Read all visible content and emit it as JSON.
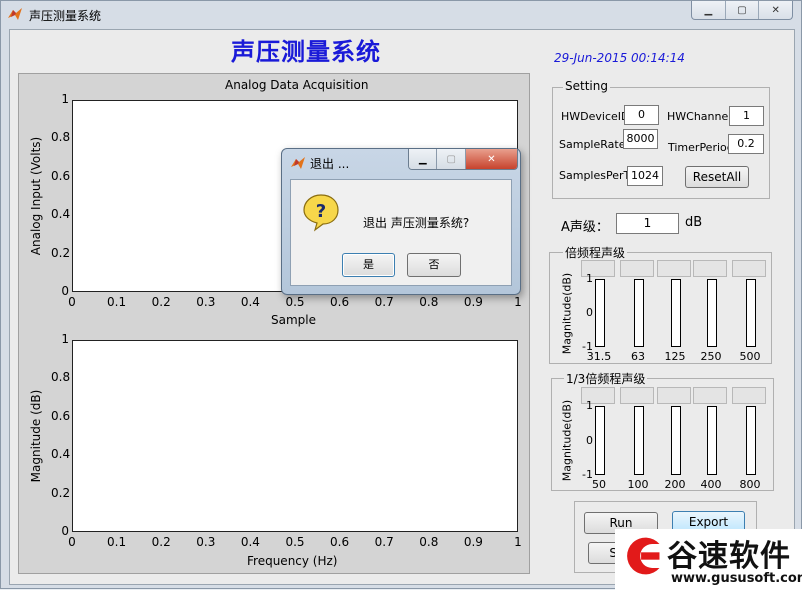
{
  "window": {
    "title": "声压测量系统"
  },
  "app": {
    "main_title": "声压测量系统",
    "datetime": "29-Jun-2015 00:14:14"
  },
  "plot1": {
    "title": "Analog Data Acquisition",
    "ylabel": "Analog Input (Volts)",
    "xlabel": "Sample",
    "yticks": [
      "0",
      "0.2",
      "0.4",
      "0.6",
      "0.8",
      "1"
    ],
    "xticks": [
      "0",
      "0.1",
      "0.2",
      "0.3",
      "0.4",
      "0.5",
      "0.6",
      "0.7",
      "0.8",
      "0.9",
      "1"
    ]
  },
  "plot2": {
    "ylabel": "Magnitude (dB)",
    "xlabel": "Frequency (Hz)",
    "yticks": [
      "0",
      "0.2",
      "0.4",
      "0.6",
      "0.8",
      "1"
    ],
    "xticks": [
      "0",
      "0.1",
      "0.2",
      "0.3",
      "0.4",
      "0.5",
      "0.6",
      "0.7",
      "0.8",
      "0.9",
      "1"
    ]
  },
  "setting": {
    "title": "Setting",
    "hw_device_label": "HWDeviceID",
    "hw_device_value": "0",
    "hw_channel_label": "HWChannel",
    "hw_channel_value": "1",
    "sample_rate_label": "SampleRate",
    "sample_rate_value": "8000",
    "timer_period_label": "TimerPeriod",
    "timer_period_value": "0.2",
    "samples_per_t_label": "SamplesPerT",
    "samples_per_t_value": "1024",
    "reset_all_label": "ResetAll"
  },
  "a_level": {
    "label": "A声级：",
    "value": "1",
    "unit": "dB"
  },
  "octave": {
    "title": "倍频程声级",
    "ylabel": "Magnitude(dB)",
    "yticks": [
      "1",
      "0",
      "-1"
    ],
    "bands": [
      "31.5",
      "63",
      "125",
      "250",
      "500"
    ]
  },
  "third_octave": {
    "title": "1/3倍频程声级",
    "ylabel": "Magnitude(dB)",
    "yticks": [
      "1",
      "0",
      "-1"
    ],
    "bands": [
      "50",
      "100",
      "200",
      "400",
      "800"
    ]
  },
  "buttons": {
    "run": "Run",
    "export": "Export Data",
    "partial": "Stop"
  },
  "dialog": {
    "title": "退出 ...",
    "message": "退出 声压测量系统?",
    "yes": "是",
    "no": "否"
  },
  "watermark": {
    "logo_text": "谷速软件",
    "url": "www.gususoft.com"
  },
  "colors": {
    "title_blue": "#1a1ad8",
    "watermark_red": "#e21a1a"
  }
}
